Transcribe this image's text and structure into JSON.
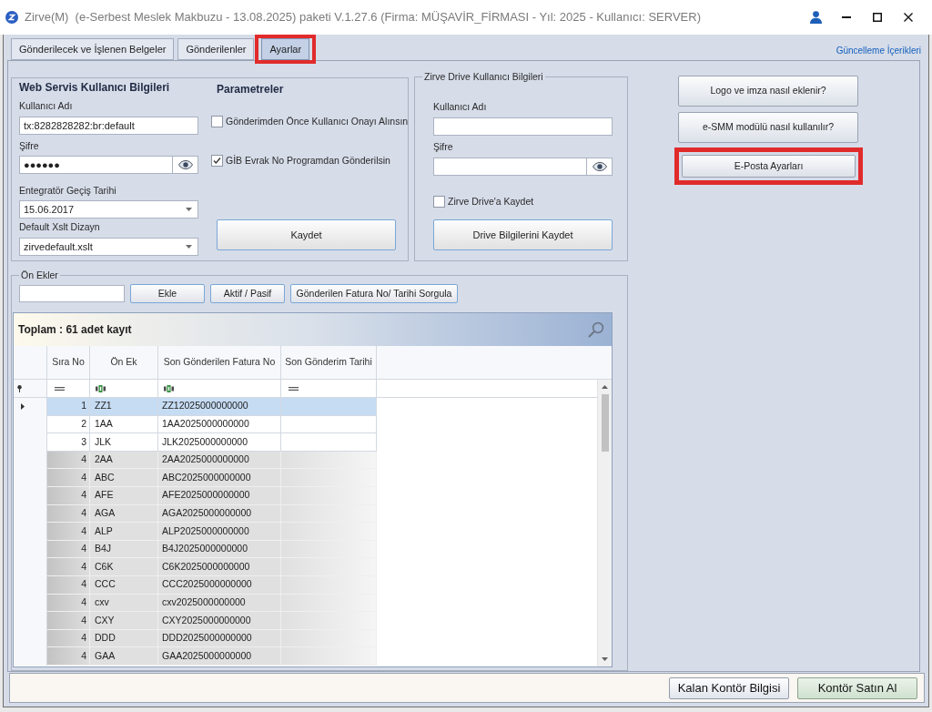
{
  "window": {
    "title": "Zirve(M)  (e-Serbest Meslek Makbuzu - 13.08.2025) paketi V.1.27.6 (Firma: MÜŞAVİR_FİRMASI - Yıl: 2025 - Kullanıcı: SERVER)"
  },
  "tabs": [
    {
      "label": "Gönderilecek ve İşlenen Belgeler",
      "selected": false,
      "highlighted": false
    },
    {
      "label": "Gönderilenler",
      "selected": false,
      "highlighted": false
    },
    {
      "label": "Ayarlar",
      "selected": true,
      "highlighted": true
    }
  ],
  "update_link": "Güncelleme İçerikleri",
  "web_service": {
    "heading": "Web Servis Kullanıcı Bilgileri",
    "fields": [
      {
        "kind": "text",
        "label": "Kullanıcı Adı",
        "value": "tx:8282828282:br:default"
      },
      {
        "kind": "password",
        "label": "Şifre",
        "value": "●●●●●●"
      },
      {
        "kind": "dropdown",
        "label": "Entegratör Geçiş Tarihi",
        "value": "15.06.2017"
      },
      {
        "kind": "dropdown",
        "label": "Default Xslt Dizayn",
        "value": "zirvedefault.xslt"
      }
    ]
  },
  "parameters": {
    "heading": "Parametreler",
    "options": [
      {
        "label": "Gönderimden Önce Kullanıcı Onayı Alınsın",
        "checked": false
      },
      {
        "label": "GİB Evrak No Programdan Gönderilsin",
        "checked": true
      }
    ],
    "save_button": "Kaydet"
  },
  "drive": {
    "legend": "Zirve Drive Kullanıcı Bilgileri",
    "fields": [
      {
        "kind": "text",
        "label": "Kullanıcı Adı"
      },
      {
        "kind": "password",
        "label": "Şifre"
      }
    ],
    "option": {
      "label": "Zirve Drive'a Kaydet",
      "checked": false
    },
    "save_button": "Drive Bilgilerini Kaydet"
  },
  "help_buttons": [
    {
      "label": "Logo ve imza nasıl eklenir?",
      "highlighted": false
    },
    {
      "label": "e-SMM modülü nasıl kullanılır?",
      "highlighted": false
    },
    {
      "label": "E-Posta Ayarları",
      "highlighted": true
    }
  ],
  "prefixes": {
    "legend": "Ön Ekler",
    "buttons": [
      "Ekle",
      "Aktif / Pasif",
      "Gönderilen Fatura No/ Tarihi Sorgula"
    ],
    "table": {
      "summary": "Toplam : 61 adet kayıt",
      "columns": [
        {
          "label": "Sıra No",
          "kind": "equals"
        },
        {
          "label": "Ön Ek",
          "kind": "text"
        },
        {
          "label": "Son Gönderilen Fatura No",
          "kind": "text"
        },
        {
          "label": "Son Gönderim Tarihi",
          "kind": "equals"
        }
      ],
      "rows": [
        {
          "cells": [
            "1",
            "ZZ1",
            "ZZ12025000000000"
          ],
          "selected": true,
          "greyed": false
        },
        {
          "cells": [
            "2",
            "1AA",
            "1AA2025000000000"
          ],
          "selected": false,
          "greyed": false
        },
        {
          "cells": [
            "3",
            "JLK",
            "JLK2025000000000"
          ],
          "selected": false,
          "greyed": false
        },
        {
          "cells": [
            "4",
            "2AA",
            "2AA2025000000000"
          ],
          "selected": false,
          "greyed": true
        },
        {
          "cells": [
            "4",
            "ABC",
            "ABC2025000000000"
          ],
          "selected": false,
          "greyed": true
        },
        {
          "cells": [
            "4",
            "AFE",
            "AFE2025000000000"
          ],
          "selected": false,
          "greyed": true
        },
        {
          "cells": [
            "4",
            "AGA",
            "AGA2025000000000"
          ],
          "selected": false,
          "greyed": true
        },
        {
          "cells": [
            "4",
            "ALP",
            "ALP2025000000000"
          ],
          "selected": false,
          "greyed": true
        },
        {
          "cells": [
            "4",
            "B4J",
            "B4J2025000000000"
          ],
          "selected": false,
          "greyed": true
        },
        {
          "cells": [
            "4",
            "C6K",
            "C6K2025000000000"
          ],
          "selected": false,
          "greyed": true
        },
        {
          "cells": [
            "4",
            "CCC",
            "CCC2025000000000"
          ],
          "selected": false,
          "greyed": true
        },
        {
          "cells": [
            "4",
            "cxv",
            "cxv2025000000000"
          ],
          "selected": false,
          "greyed": true
        },
        {
          "cells": [
            "4",
            "CXY",
            "CXY2025000000000"
          ],
          "selected": false,
          "greyed": true
        },
        {
          "cells": [
            "4",
            "DDD",
            "DDD2025000000000"
          ],
          "selected": false,
          "greyed": true
        },
        {
          "cells": [
            "4",
            "GAA",
            "GAA2025000000000"
          ],
          "selected": false,
          "greyed": true
        }
      ]
    }
  },
  "status_bar": {
    "buttons": [
      {
        "label": "Kalan Kontör Bilgisi",
        "kind": "info"
      },
      {
        "label": "Kontör Satın Al",
        "kind": "buy"
      }
    ]
  }
}
